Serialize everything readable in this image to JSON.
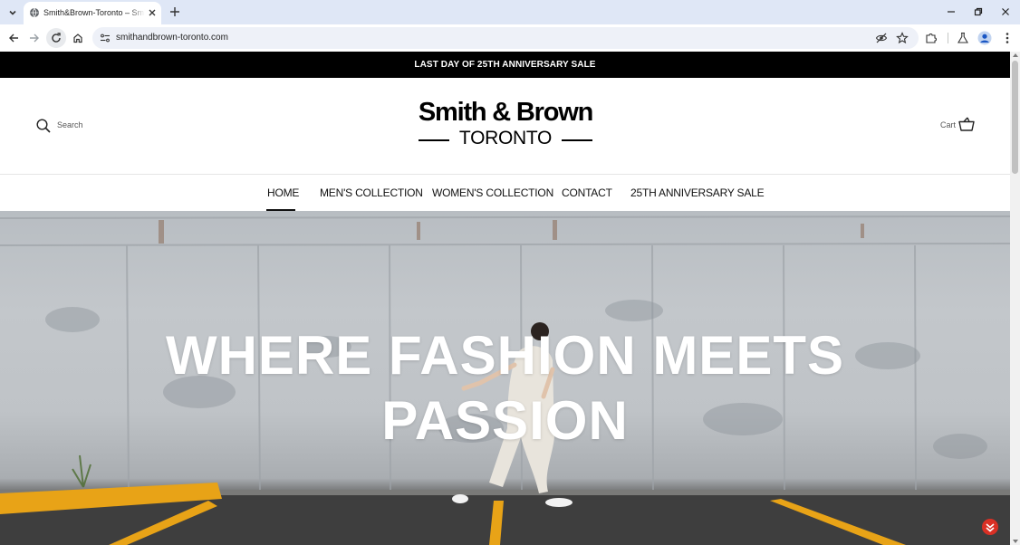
{
  "browser": {
    "tab_title": "Smith&Brown-Toronto – Smith&Brown",
    "url": "smithandbrown-toronto.com"
  },
  "site": {
    "announcement": "LAST DAY OF 25TH ANNIVERSARY SALE",
    "header": {
      "search_label": "Search",
      "logo_main": "Smith & Brown",
      "logo_city": "TORONTO",
      "cart_label": "Cart"
    },
    "nav": {
      "items": [
        {
          "label": "HOME",
          "active": true
        },
        {
          "label": "MEN'S COLLECTION",
          "active": false
        },
        {
          "label": "WOMEN'S COLLECTION",
          "active": false
        },
        {
          "label": "CONTACT",
          "active": false
        },
        {
          "label": "25TH ANNIVERSARY SALE",
          "active": false
        }
      ]
    },
    "hero": {
      "title_line1": "WHERE FASHION MEETS",
      "title_line2": "PASSION"
    }
  },
  "colors": {
    "tabbar_bg": "#dfe7f6",
    "announcement_bg": "#000000",
    "chat_badge": "#d93025",
    "parking_line": "#e8a317"
  }
}
